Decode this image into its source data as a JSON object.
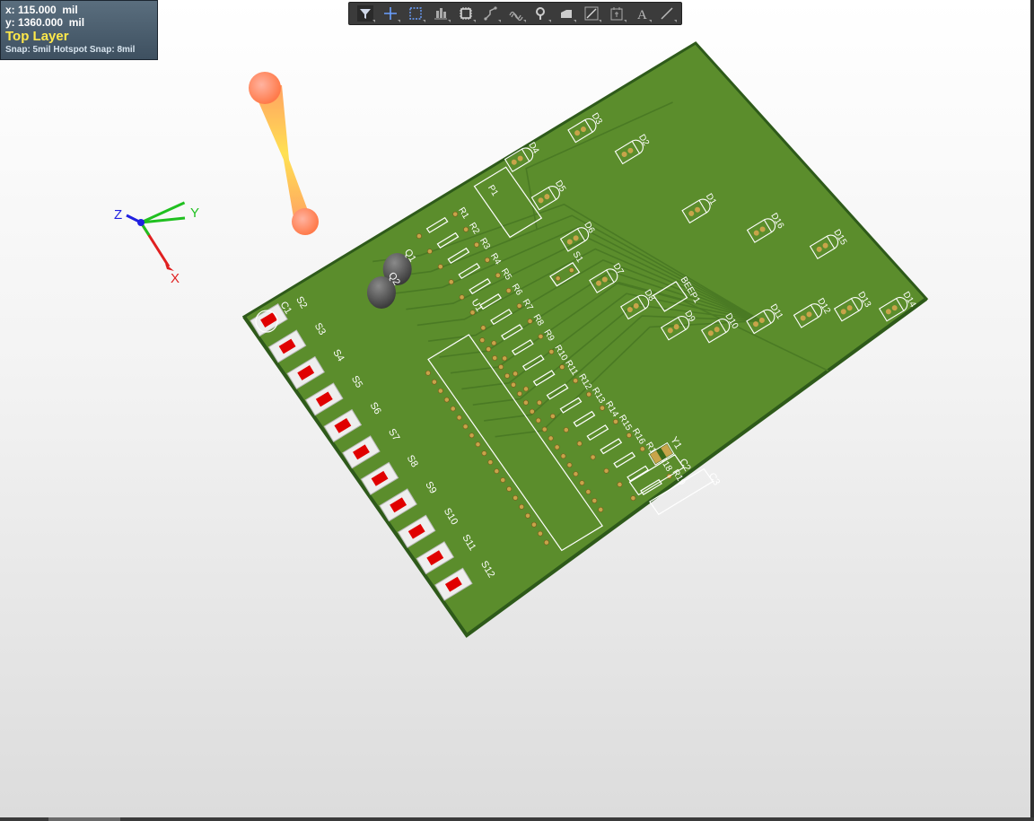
{
  "status_panel": {
    "x_label": "x:",
    "x_value": "115.000  mil",
    "y_label": "y:",
    "y_value": "1360.000  mil",
    "layer": "Top Layer",
    "snap": "Snap: 5mil Hotspot Snap: 8mil"
  },
  "toolbar": {
    "tools": [
      {
        "name": "filter-icon",
        "active": true
      },
      {
        "name": "crosshair-icon"
      },
      {
        "name": "select-rectangle-icon"
      },
      {
        "name": "align-icon"
      },
      {
        "name": "component-icon"
      },
      {
        "name": "route-icon"
      },
      {
        "name": "diff-pair-icon"
      },
      {
        "name": "via-icon"
      },
      {
        "name": "polygon-icon"
      },
      {
        "name": "dimension-icon"
      },
      {
        "name": "keepout-icon"
      },
      {
        "name": "text-icon"
      },
      {
        "name": "line-icon"
      }
    ]
  },
  "axes": {
    "x": "X",
    "y": "Y",
    "z": "Z"
  },
  "colors": {
    "board": "#5b8d2c",
    "board_edge": "#2e5a1a",
    "silkscreen": "#ffffff",
    "pad": "#c8a44a",
    "trace": "#4a7a24",
    "switch_button": "#e00000",
    "x_axis": "#e02020",
    "y_axis": "#20c020",
    "z_axis": "#2020e0"
  },
  "components": {
    "resistors": [
      "R1",
      "R2",
      "R3",
      "R4",
      "R5",
      "R6",
      "R7",
      "R8",
      "R9",
      "R10",
      "R11",
      "R12",
      "R13",
      "R14",
      "R15",
      "R16",
      "R17",
      "R18",
      "R19"
    ],
    "switches": [
      "S1",
      "S2",
      "S3",
      "S4",
      "S5",
      "S6",
      "S7",
      "S8",
      "S9",
      "S10",
      "S11",
      "S12"
    ],
    "leds": [
      "D1",
      "D2",
      "D3",
      "D4",
      "D5",
      "D6",
      "D7",
      "D8",
      "D9",
      "D10",
      "D11",
      "D12",
      "D13",
      "D14",
      "D15",
      "D16"
    ],
    "transistors": [
      "Q1",
      "Q2"
    ],
    "capacitors": [
      "C1",
      "C2",
      "C3"
    ],
    "misc": {
      "header": "P1",
      "crystal": "Y1",
      "buzzer": "BEEP1",
      "ic": "U1"
    }
  }
}
